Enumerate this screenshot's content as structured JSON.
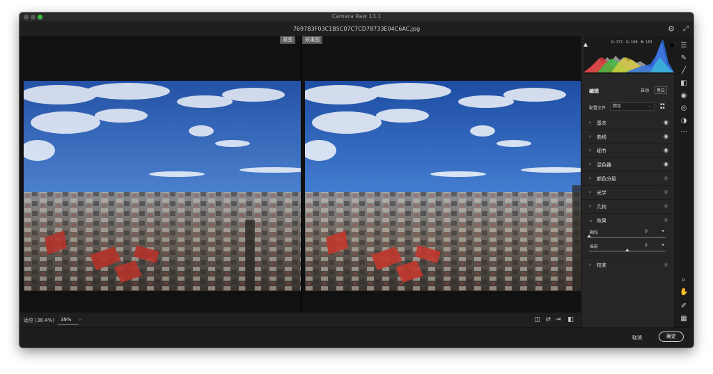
{
  "window": {
    "app_title": "Camera Raw 13.1",
    "file_name": "7697B3F03C1B5C07C7CD78733E04C6AC.jpg"
  },
  "icons": {
    "gear": "gear-icon",
    "expand": "expand-icon",
    "edit": "edit-sliders-icon",
    "heal": "healing-brush-icon",
    "brush": "adjustment-brush-icon",
    "gradient": "graduated-filter-icon",
    "radial": "radial-filter-icon",
    "redeye": "red-eye-icon",
    "presets": "presets-icon",
    "more": "more-icon",
    "zoom": "zoom-icon",
    "hand": "hand-icon",
    "sampler": "color-sampler-icon",
    "grid": "grid-icon"
  },
  "view": {
    "before_label": "原图",
    "after_label": "效果图"
  },
  "status": {
    "fit_label": "适应 (38.4%)",
    "zoom_value": "39%",
    "icons": [
      "before-after-view-icon",
      "swap-settings-icon",
      "copy-settings-icon",
      "toggle-view-icon"
    ]
  },
  "histogram": {
    "rgb": {
      "r_label": "R:",
      "r": "173",
      "g_label": "G:",
      "g": "168",
      "b_label": "B:",
      "b": "153"
    },
    "colors": {
      "red": "#e23b3b",
      "green": "#3fbf3f",
      "blue": "#2f6ee8",
      "yellow": "#e2d13b",
      "cyan": "#3bd0d8",
      "gray": "#b8b8b8"
    }
  },
  "edit": {
    "title": "编辑",
    "auto_label": "自动",
    "bw_label": "黑白",
    "profile_label": "配置文件",
    "profile_value": "颜色"
  },
  "sections": [
    {
      "label": "基本",
      "eye": true
    },
    {
      "label": "曲线",
      "eye": true
    },
    {
      "label": "细节",
      "eye": true
    },
    {
      "label": "混色器",
      "eye": true
    },
    {
      "label": "颜色分级",
      "eye": false
    },
    {
      "label": "光学",
      "eye": false
    },
    {
      "label": "几何",
      "eye": false
    },
    {
      "label": "效果",
      "eye": false,
      "expanded": true
    },
    {
      "label": "校准",
      "eye": false
    }
  ],
  "effects": [
    {
      "label": "颗粒",
      "value": "0",
      "position": 0.0
    },
    {
      "label": "晕影",
      "value": "0",
      "position": 0.5
    }
  ],
  "footer": {
    "cancel_label": "取消",
    "ok_label": "确定"
  }
}
